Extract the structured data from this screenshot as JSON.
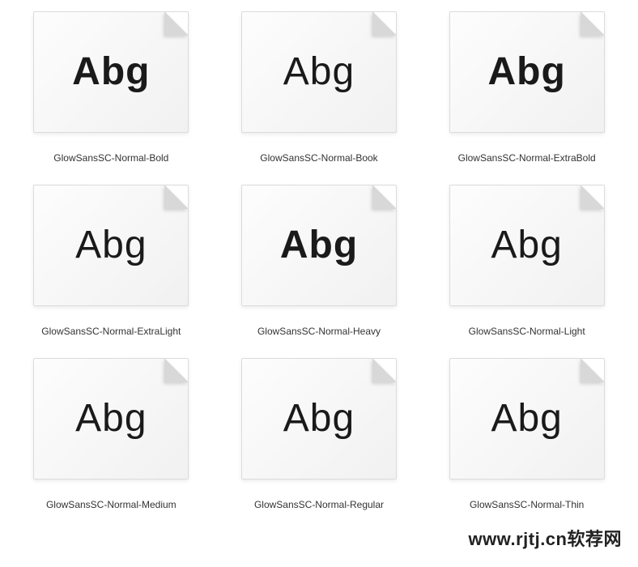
{
  "preview_text": "Abg",
  "watermark": "www.rjtj.cn软荐网",
  "fonts": [
    {
      "name": "GlowSansSC-Normal-Bold",
      "weight_class": "w-bold"
    },
    {
      "name": "GlowSansSC-Normal-Book",
      "weight_class": "w-book"
    },
    {
      "name": "GlowSansSC-Normal-ExtraBold",
      "weight_class": "w-extrabold"
    },
    {
      "name": "GlowSansSC-Normal-ExtraLight",
      "weight_class": "w-extralight"
    },
    {
      "name": "GlowSansSC-Normal-Heavy",
      "weight_class": "w-heavy"
    },
    {
      "name": "GlowSansSC-Normal-Light",
      "weight_class": "w-light"
    },
    {
      "name": "GlowSansSC-Normal-Medium",
      "weight_class": "w-medium"
    },
    {
      "name": "GlowSansSC-Normal-Regular",
      "weight_class": "w-regular"
    },
    {
      "name": "GlowSansSC-Normal-Thin",
      "weight_class": "w-thin"
    }
  ]
}
